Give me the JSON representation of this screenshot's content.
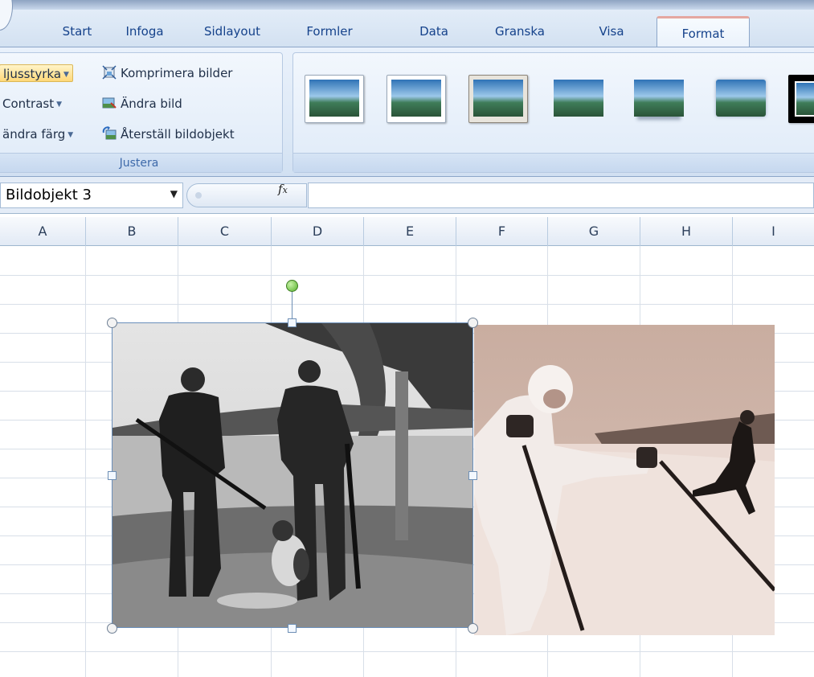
{
  "ribbon": {
    "tabs": [
      {
        "label": "Start"
      },
      {
        "label": "Infoga"
      },
      {
        "label": "Sidlayout"
      },
      {
        "label": "Formler"
      },
      {
        "label": "Data"
      },
      {
        "label": "Granska"
      },
      {
        "label": "Visa"
      },
      {
        "label": "Format",
        "active": true
      }
    ],
    "adjust_group": {
      "label": "Justera",
      "brightness": "ljusstyrka",
      "contrast": "Contrast",
      "recolor": "ändra färg",
      "compress": "Komprimera bilder",
      "change_picture": "Ändra bild",
      "reset_picture": "Återställ bildobjekt"
    },
    "picture_styles": [
      "style-1",
      "style-2",
      "style-3",
      "style-4",
      "style-5",
      "style-6",
      "style-7"
    ]
  },
  "formula_bar": {
    "name_box": "Bildobjekt 3",
    "fx_label": "fx",
    "formula": ""
  },
  "columns": [
    "A",
    "B",
    "C",
    "D",
    "E",
    "F",
    "G",
    "H",
    "I"
  ],
  "selected_object": "Bildobjekt 3",
  "icons": [
    "dropdown-arrow-icon",
    "compress-pictures-icon",
    "change-picture-icon",
    "reset-picture-icon",
    "fx-icon",
    "rotation-handle-icon"
  ],
  "colors": {
    "accent_tab": "#e4a8a0",
    "ribbon_text": "#15428b",
    "selection": "#6a8fbb"
  }
}
